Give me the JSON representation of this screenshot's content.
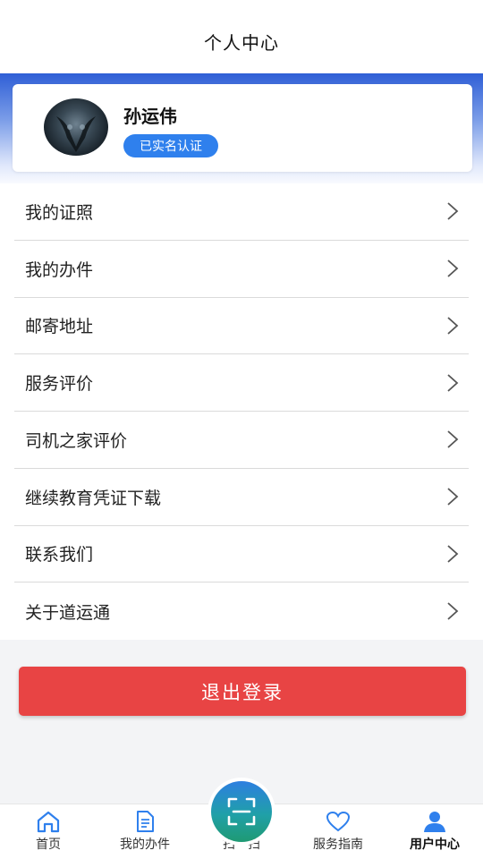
{
  "header": {
    "title": "个人中心"
  },
  "profile": {
    "name": "孙运伟",
    "badge": "已实名认证"
  },
  "menu": [
    {
      "label": "我的证照"
    },
    {
      "label": "我的办件"
    },
    {
      "label": "邮寄地址"
    },
    {
      "label": "服务评价"
    },
    {
      "label": "司机之家评价"
    },
    {
      "label": "继续教育凭证下载"
    },
    {
      "label": "联系我们"
    },
    {
      "label": "关于道运通"
    }
  ],
  "logout": {
    "label": "退出登录"
  },
  "tabs": [
    {
      "label": "首页",
      "icon": "home-icon"
    },
    {
      "label": "我的办件",
      "icon": "document-icon"
    },
    {
      "label": "扫一扫",
      "icon": "scan-icon"
    },
    {
      "label": "服务指南",
      "icon": "heart-icon"
    },
    {
      "label": "用户中心",
      "icon": "user-icon",
      "active": true
    }
  ],
  "colors": {
    "accent": "#2f80ed",
    "logout": "#e84444",
    "header_gradient": "#2f5fd6"
  }
}
